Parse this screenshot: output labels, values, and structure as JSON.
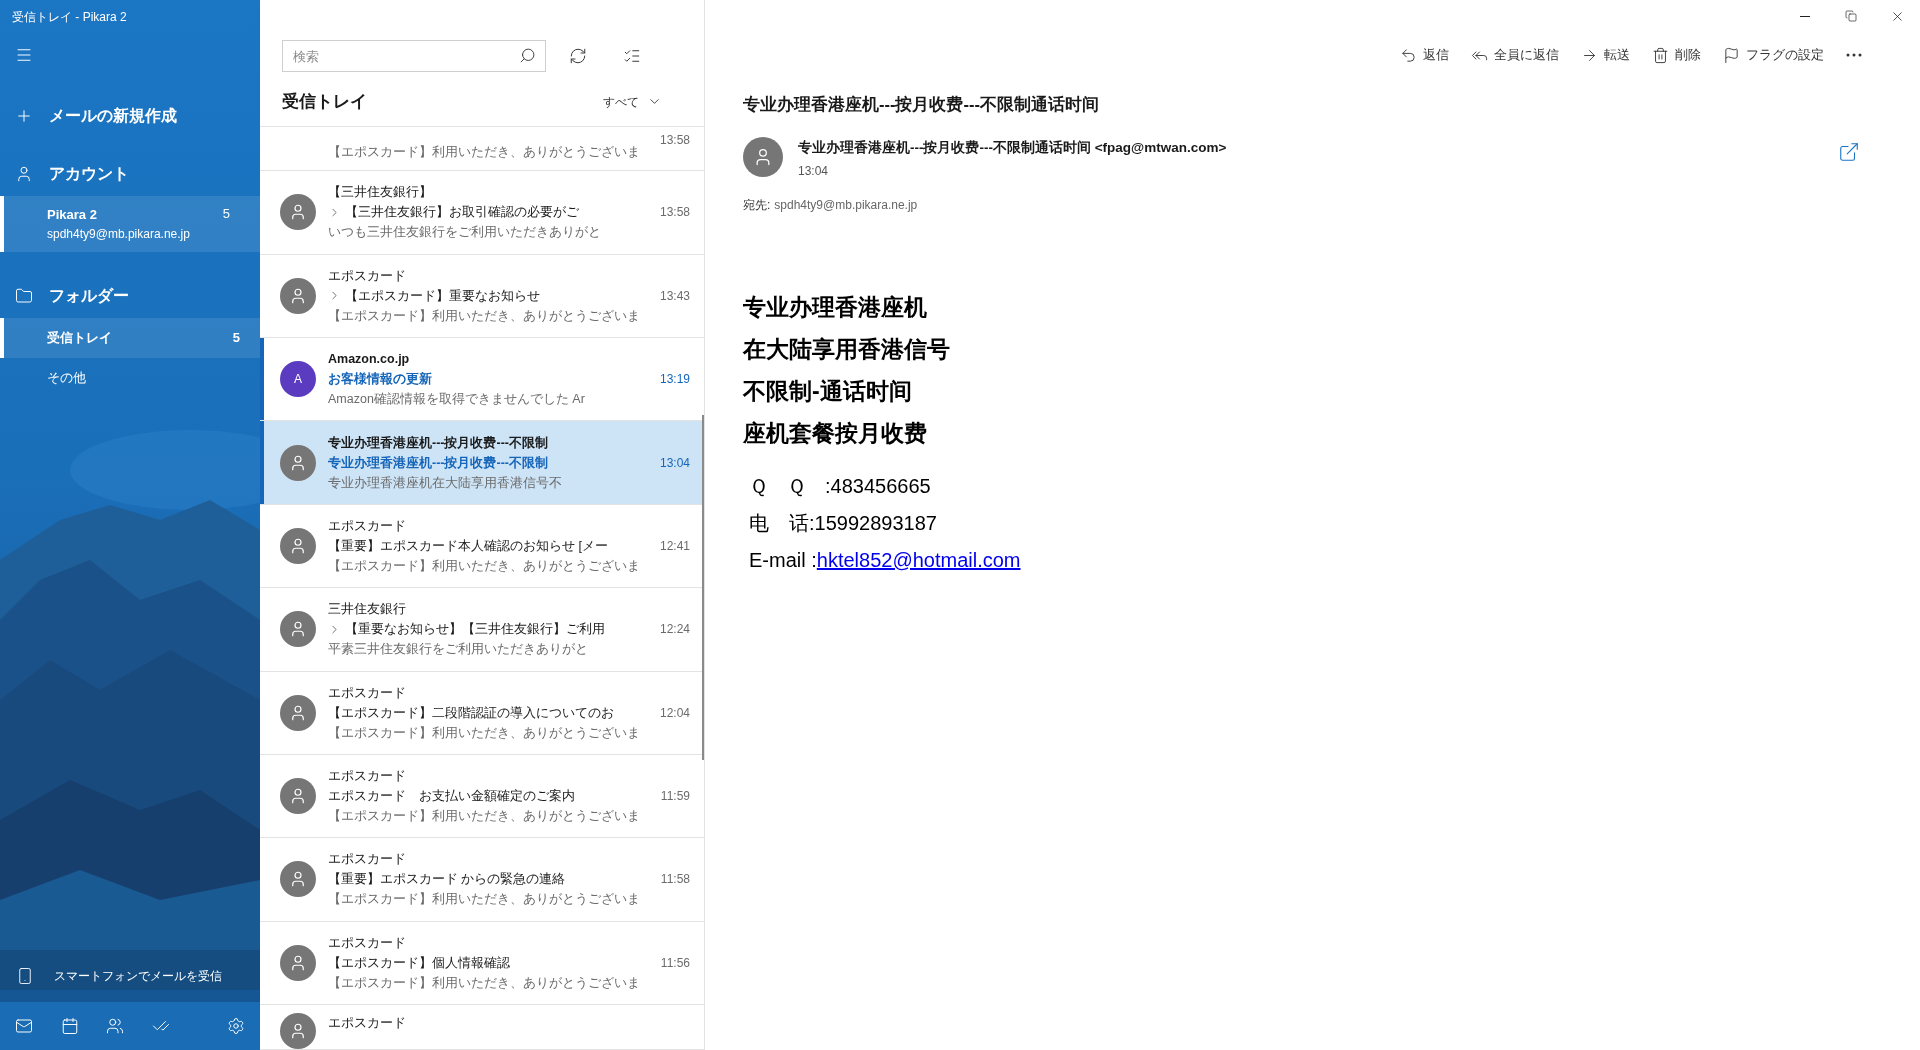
{
  "window": {
    "title": "受信トレイ - Pikara 2"
  },
  "sidebar": {
    "new_mail": "メールの新規作成",
    "accounts_heading": "アカウント",
    "accounts": [
      {
        "name": "Pikara 2",
        "email": "spdh4ty9@mb.pikara.ne.jp",
        "count": "5",
        "selected": true
      }
    ],
    "folders_heading": "フォルダー",
    "folders": [
      {
        "name": "受信トレイ",
        "count": "5",
        "selected": true
      },
      {
        "name": "その他",
        "selected": false
      }
    ],
    "phone_promo": "スマートフォンでメールを受信",
    "nav": [
      {
        "kind": "mail"
      },
      {
        "kind": "calendar"
      },
      {
        "kind": "people"
      },
      {
        "kind": "todo"
      },
      {
        "kind": "settings"
      }
    ]
  },
  "message_list": {
    "search": {
      "placeholder": "検索"
    },
    "title": "受信トレイ",
    "filter": "すべて",
    "messages": [
      {
        "preview": "【エポスカード】利用いただき、ありがとうございま",
        "time": "13:58",
        "thread": false,
        "unread": false,
        "selected": false
      },
      {
        "sender": "【三井住友銀行】",
        "subject": "【三井住友銀行】お取引確認の必要がご",
        "preview": "いつも三井住友銀行をご利用いただきありがと",
        "time": "13:58",
        "thread": true,
        "unread": false,
        "selected": false
      },
      {
        "sender": "エポスカード",
        "subject": "【エポスカード】重要なお知らせ",
        "preview": "【エポスカード】利用いただき、ありがとうございま",
        "time": "13:43",
        "thread": true,
        "unread": false,
        "selected": false
      },
      {
        "sender": "Amazon.co.jp",
        "subject": "お客様情報の更新",
        "preview": "Amazon確認情報を取得できませんでした Ar",
        "time": "13:19",
        "thread": false,
        "unread": true,
        "selected": false,
        "avatar": {
          "initial": "A",
          "color": "#5b3cc0"
        }
      },
      {
        "sender": "专业办理香港座机---按月收费---不限制",
        "subject": "专业办理香港座机---按月收费---不限制",
        "preview": "专业办理香港座机在大陆享用香港信号不",
        "time": "13:04",
        "thread": false,
        "unread": true,
        "selected": true
      },
      {
        "sender": "エポスカード",
        "subject": "【重要】エポスカード本人確認のお知らせ [メー",
        "preview": "【エポスカード】利用いただき、ありがとうございま",
        "time": "12:41",
        "thread": false,
        "unread": false,
        "selected": false
      },
      {
        "sender": "三井住友銀行",
        "subject": "【重要なお知らせ】【三井住友銀行】ご利用",
        "preview": "平素三井住友銀行をご利用いただきありがと",
        "time": "12:24",
        "thread": true,
        "unread": false,
        "selected": false
      },
      {
        "sender": "エポスカード",
        "subject": "【エポスカード】二段階認証の導入についてのお",
        "preview": "【エポスカード】利用いただき、ありがとうございま",
        "time": "12:04",
        "thread": false,
        "unread": false,
        "selected": false
      },
      {
        "sender": "エポスカード",
        "subject": "エポスカード　お支払い金額確定のご案内",
        "preview": "【エポスカード】利用いただき、ありがとうございま",
        "time": "11:59",
        "thread": false,
        "unread": false,
        "selected": false
      },
      {
        "sender": "エポスカード",
        "subject": "【重要】エポスカード からの緊急の連絡",
        "preview": "【エポスカード】利用いただき、ありがとうございま",
        "time": "11:58",
        "thread": false,
        "unread": false,
        "selected": false
      },
      {
        "sender": "エポスカード",
        "subject": "【エポスカード】個人情報確認",
        "preview": "【エポスカード】利用いただき、ありがとうございま",
        "time": "11:56",
        "thread": false,
        "unread": false,
        "selected": false
      },
      {
        "sender": "エポスカード",
        "thread": false,
        "unread": false,
        "selected": false
      }
    ]
  },
  "reading_pane": {
    "toolbar": [
      {
        "kind": "reply",
        "label": "返信"
      },
      {
        "kind": "reply_all",
        "label": "全員に返信"
      },
      {
        "kind": "forward",
        "label": "転送"
      },
      {
        "kind": "delete",
        "label": "削除"
      },
      {
        "kind": "flag",
        "label": "フラグの設定"
      },
      {
        "kind": "more"
      }
    ],
    "subject": "专业办理香港座机---按月收费---不限制通话时间",
    "from": "专业办理香港座机---按月收费---不限制通话时间 <fpag@mtwan.com>",
    "time": "13:04",
    "to_label": "宛先:",
    "to": "spdh4ty9@mb.pikara.ne.jp",
    "body_lines": [
      "专业办理香港座机",
      "在大陆享用香港信号",
      "不限制-通话时间",
      "座机套餐按月收费"
    ],
    "contacts": [
      {
        "kind": "text",
        "label": "Ｑ　Ｑ　:",
        "value": "483456665"
      },
      {
        "kind": "text",
        "label": "电　话:",
        "value": "15992893187"
      },
      {
        "kind": "link",
        "label": "E-mail :",
        "value": "hktel852@hotmail.com"
      }
    ]
  }
}
